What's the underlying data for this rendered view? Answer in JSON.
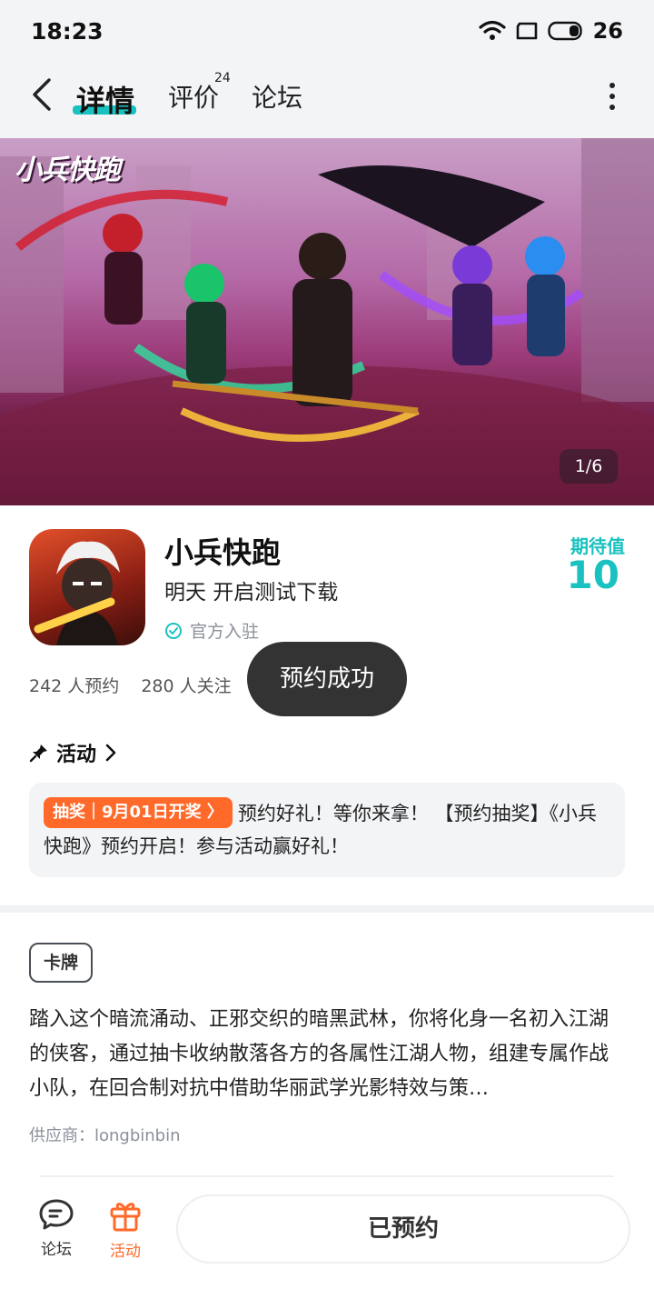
{
  "status_bar": {
    "time": "18:23",
    "battery": "26"
  },
  "nav": {
    "tabs": [
      {
        "label": "详情",
        "active": true
      },
      {
        "label": "评价",
        "badge": "24"
      },
      {
        "label": "论坛"
      }
    ]
  },
  "banner": {
    "logo_text": "小兵快跑",
    "counter": "1/6"
  },
  "game": {
    "name": "小兵快跑",
    "status": "明天 开启测试下载",
    "official": "官方入驻",
    "expect_label": "期待值",
    "expect_value": "10",
    "reservations": "242 人预约",
    "followers": "280 人关注"
  },
  "toast": "预约成功",
  "activity": {
    "header": "活动",
    "tag": "抽奖｜9月01日开奖 〉",
    "text": "预约好礼！等你来拿！ 【预约抽奖】《小兵快跑》预约开启！参与活动赢好礼！"
  },
  "details": {
    "genre_tag": "卡牌",
    "description": "踏入这个暗流涌动、正邪交织的暗黑武林，你将化身一名初入江湖的侠客，通过抽卡收纳散落各方的各属性江湖人物，组建专属作战小队，在回合制对抗中借助华丽武学光影特效与策…",
    "supplier": "供应商：longbinbin"
  },
  "bottom_bar": {
    "forum_label": "论坛",
    "activity_label": "活动",
    "reserved_label": "已预约"
  },
  "colors": {
    "accent": "#19c2c0",
    "orange": "#ff6a2b"
  }
}
